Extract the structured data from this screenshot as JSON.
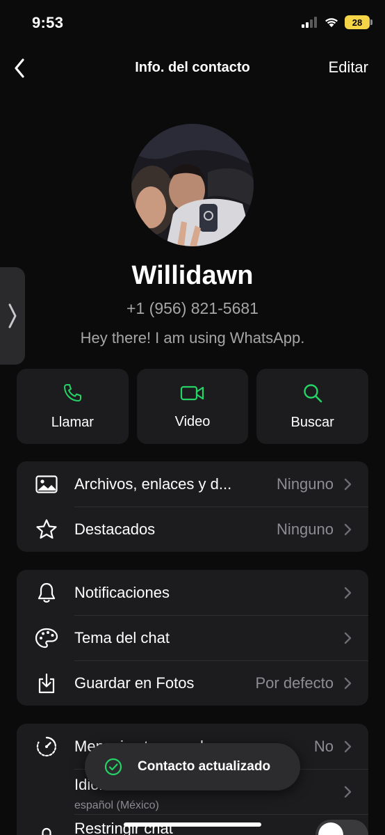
{
  "status_bar": {
    "time": "9:53",
    "battery": "28"
  },
  "nav": {
    "title": "Info. del contacto",
    "edit_label": "Editar"
  },
  "contact": {
    "name": "Willidawn",
    "phone": "+1 (956) 821-5681",
    "about": "Hey there! I am using WhatsApp."
  },
  "actions": [
    {
      "label": "Llamar",
      "icon": "phone-icon"
    },
    {
      "label": "Video",
      "icon": "video-icon"
    },
    {
      "label": "Buscar",
      "icon": "search-icon"
    }
  ],
  "section1": [
    {
      "label": "Archivos, enlaces y d...",
      "value": "Ninguno",
      "icon": "image-icon"
    },
    {
      "label": "Destacados",
      "value": "Ninguno",
      "icon": "star-icon"
    }
  ],
  "section2": [
    {
      "label": "Notificaciones",
      "value": "",
      "icon": "bell-icon"
    },
    {
      "label": "Tema del chat",
      "value": "",
      "icon": "palette-icon"
    },
    {
      "label": "Guardar en Fotos",
      "value": "Por defecto",
      "icon": "download-icon"
    }
  ],
  "section3": [
    {
      "label": "Mensajes temporales",
      "value": "No",
      "icon": "timer-icon"
    },
    {
      "label": "Idioma de la traducción",
      "sublabel": "español (México)",
      "icon": "translate-icon"
    },
    {
      "label": "Restringir chat",
      "icon": "lock-icon"
    }
  ],
  "toast": {
    "text": "Contacto actualizado"
  },
  "colors": {
    "accent": "#25d366",
    "background": "#0b0b0b",
    "card": "#1c1c1e",
    "secondary_text": "#8d8d92"
  }
}
